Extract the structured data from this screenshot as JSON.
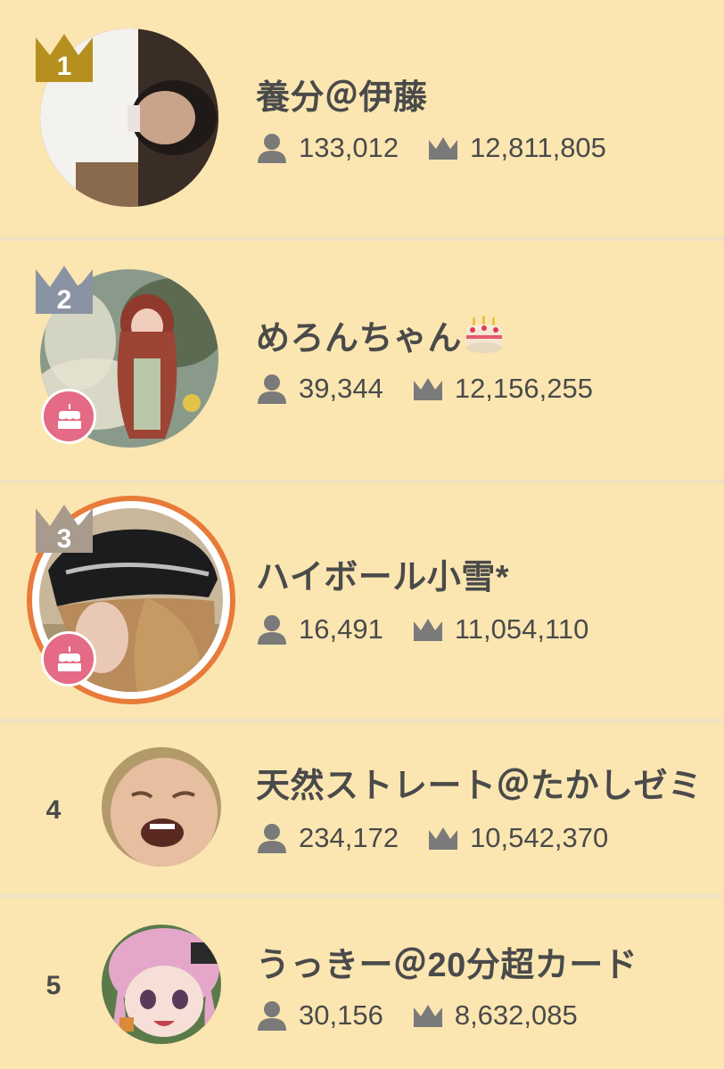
{
  "ranking": [
    {
      "rank": "1",
      "name": "養分＠伊藤",
      "followers": "133,012",
      "points": "12,811,805",
      "crown_color": "#b5901e",
      "birthday_badge": false
    },
    {
      "rank": "2",
      "name": "めろんちゃん",
      "followers": "39,344",
      "points": "12,156,255",
      "crown_color": "#8a93a3",
      "birthday_badge": true,
      "name_emoji": "cake-emoji"
    },
    {
      "rank": "3",
      "name": "ハイボール小雪*",
      "followers": "16,491",
      "points": "11,054,110",
      "crown_color": "#a99a8e",
      "birthday_badge": true,
      "ring_color": "#e87b3a"
    },
    {
      "rank": "4",
      "name": "天然ストレート＠たかしゼミ",
      "followers": "234,172",
      "points": "10,542,370",
      "birthday_badge": false
    },
    {
      "rank": "5",
      "name": "うっきー＠20分超カード",
      "followers": "30,156",
      "points": "8,632,085",
      "birthday_badge": false
    }
  ],
  "icons": {
    "followers": "person-icon",
    "points": "crown-icon",
    "badge": "birthday-cake-icon"
  },
  "colors": {
    "background": "#fbe6b1",
    "divider": "#efe1c3",
    "text": "#4a4a4a",
    "icon": "#7a7a7a",
    "badge": "#e46a85"
  }
}
